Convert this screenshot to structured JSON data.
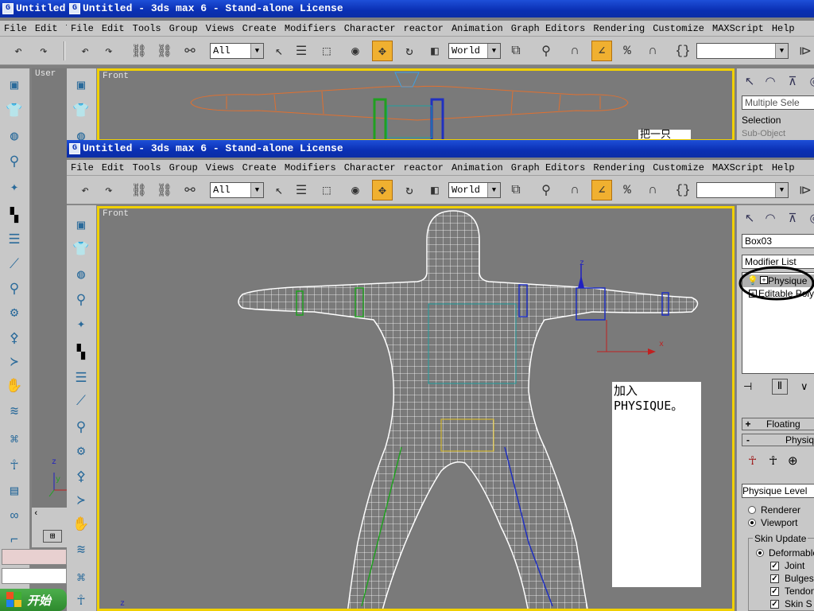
{
  "back_window": {
    "title": "Untitled - 3ds max 6 - Stand-alone License",
    "far_title_fragment": "Untitled",
    "far_menu_file": "File",
    "far_menu_edit": "Edit",
    "far_menu_t": "T",
    "viewport_label": "Front",
    "user_viewport_label": "User",
    "command_panel": {
      "name_field": "Multiple Sele",
      "selection_label": "Selection",
      "subobject_label": "Sub-Object"
    },
    "note_fragment": "把一只"
  },
  "front_window": {
    "title": "Untitled - 3ds max 6 - Stand-alone License",
    "menu": [
      "File",
      "Edit",
      "Tools",
      "Group",
      "Views",
      "Create",
      "Modifiers",
      "Character",
      "reactor",
      "Animation",
      "Graph Editors",
      "Rendering",
      "Customize",
      "MAXScript",
      "Help"
    ],
    "toolbar": {
      "selection_filter": "All",
      "reference_coord": "World",
      "named_selection": ""
    },
    "viewport_label": "Front",
    "annotation_note": [
      "加入",
      "PHYSIQUE。"
    ],
    "command_panel": {
      "object_name": "Box03",
      "modifier_list": "Modifier List",
      "stack": [
        {
          "label": "Physique",
          "selected": true
        },
        {
          "label": "Editable Poly",
          "selected": false
        }
      ],
      "rollouts": [
        {
          "sign": "+",
          "label": "Floating"
        },
        {
          "sign": "-",
          "label": "Physique"
        }
      ],
      "physique_level": "Physique Level",
      "render_options": [
        {
          "label": "Renderer",
          "checked": false
        },
        {
          "label": "Viewport",
          "checked": true
        }
      ],
      "skin_update_group": "Skin Update",
      "deformable_label": "Deformable",
      "checkboxes": [
        {
          "label": "Joint",
          "checked": true
        },
        {
          "label": "Bulges",
          "checked": true
        },
        {
          "label": "Tendons",
          "checked": true
        },
        {
          "label": "Skin S",
          "checked": true
        }
      ]
    }
  },
  "taskbar": {
    "start_label": "开始"
  },
  "axis_labels": {
    "x": "x",
    "y": "y",
    "z": "z"
  },
  "colors": {
    "active_viewport_border": "#f0d000",
    "titlebar": "#0a2fb3",
    "active_tool": "#f0b030"
  }
}
